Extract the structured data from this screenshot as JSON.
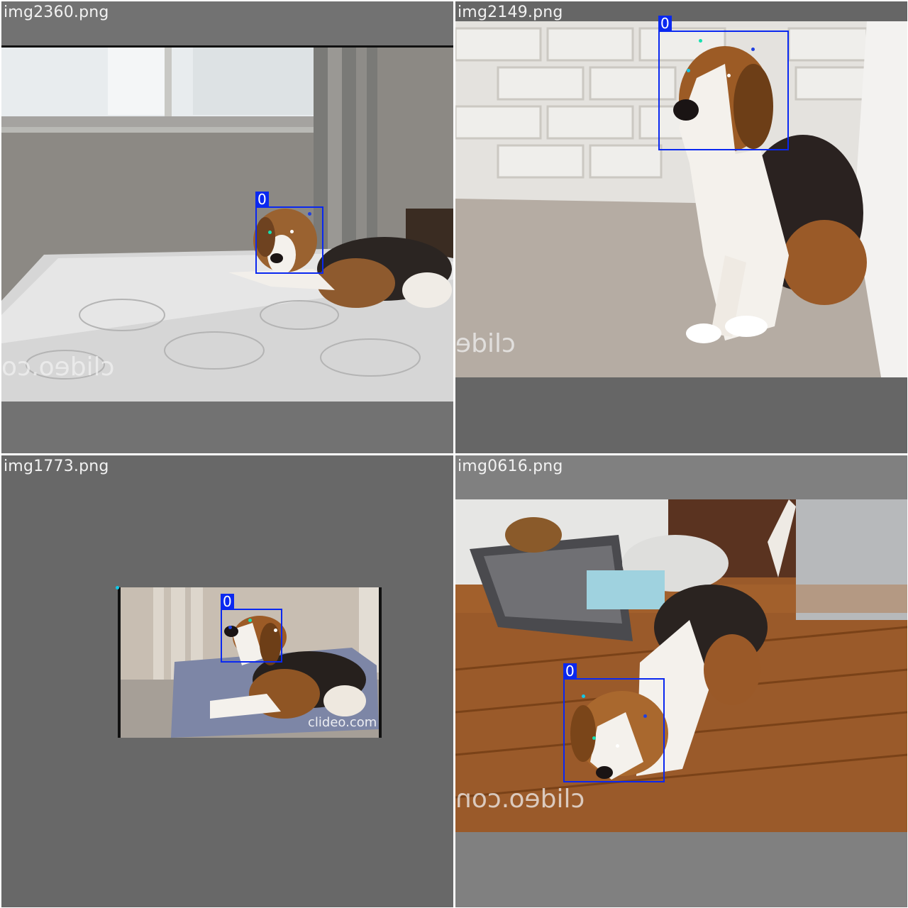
{
  "tiles": [
    {
      "filename": "img2360.png",
      "label": "0",
      "watermark": "clideo.co"
    },
    {
      "filename": "img2149.png",
      "label": "0",
      "watermark": "clide"
    },
    {
      "filename": "img1773.png",
      "label": "0",
      "watermark": "clideo.com"
    },
    {
      "filename": "img0616.png",
      "label": "0",
      "watermark": "clideo.con"
    }
  ],
  "colors": {
    "box": "#0a28f0",
    "kp_eye_left": "#16e0b0",
    "kp_eye_right": "#2040e0",
    "kp_nose": "#ffffff",
    "kp_extra": "#10c8e8"
  }
}
